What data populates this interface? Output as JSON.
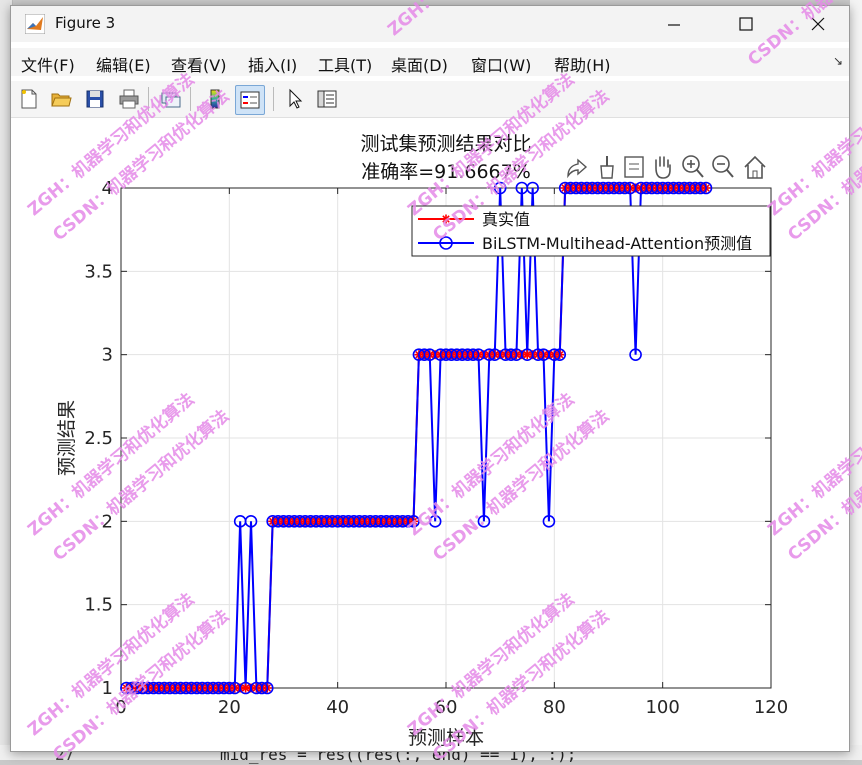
{
  "window": {
    "title": "Figure 3"
  },
  "menubar": {
    "items": [
      {
        "label": "文件(F)"
      },
      {
        "label": "编辑(E)"
      },
      {
        "label": "查看(V)"
      },
      {
        "label": "插入(I)"
      },
      {
        "label": "工具(T)"
      },
      {
        "label": "桌面(D)"
      },
      {
        "label": "窗口(W)"
      },
      {
        "label": "帮助(H)"
      }
    ]
  },
  "toolbar": {
    "buttons": [
      "new-figure",
      "open-file",
      "save",
      "print",
      "link-data",
      "colorbar",
      "legend",
      "pointer",
      "property-inspector"
    ]
  },
  "background": {
    "code_line": "mid_res = res((res(:, end) == 1), :);",
    "line_number": "27"
  },
  "watermark": {
    "line1": "ZGH：机器学习和优化算法",
    "line2": "CSDN：机器学习和优化算法"
  },
  "chart_data": {
    "type": "line",
    "title": "测试集预测结果对比",
    "subtitle": "准确率=91.6667%",
    "xlabel": "预测样本",
    "ylabel": "预测结果",
    "xlim": [
      0,
      120
    ],
    "ylim": [
      1,
      4
    ],
    "xticks": [
      "0",
      "20",
      "40",
      "60",
      "80",
      "100",
      "120"
    ],
    "yticks": [
      "1",
      "1.5",
      "2",
      "2.5",
      "3",
      "3.5",
      "4"
    ],
    "grid": true,
    "legend_position": "top-right",
    "series": [
      {
        "name": "真实值",
        "color": "#ff0000",
        "marker": "asterisk",
        "values": [
          1,
          1,
          1,
          1,
          1,
          1,
          1,
          1,
          1,
          1,
          1,
          1,
          1,
          1,
          1,
          1,
          1,
          1,
          1,
          1,
          1,
          1,
          1,
          1,
          1,
          1,
          1,
          2,
          2,
          2,
          2,
          2,
          2,
          2,
          2,
          2,
          2,
          2,
          2,
          2,
          2,
          2,
          2,
          2,
          2,
          2,
          2,
          2,
          2,
          2,
          2,
          2,
          2,
          2,
          3,
          3,
          3,
          3,
          3,
          3,
          3,
          3,
          3,
          3,
          3,
          3,
          3,
          3,
          3,
          3,
          3,
          3,
          3,
          3,
          3,
          3,
          3,
          3,
          3,
          3,
          3,
          4,
          4,
          4,
          4,
          4,
          4,
          4,
          4,
          4,
          4,
          4,
          4,
          4,
          4,
          4,
          4,
          4,
          4,
          4,
          4,
          4,
          4,
          4,
          4,
          4,
          4,
          4
        ]
      },
      {
        "name": "BiLSTM-Multihead-Attention预测值",
        "color": "#0000ff",
        "marker": "circle",
        "values": [
          1,
          1,
          1,
          1,
          1,
          1,
          1,
          1,
          1,
          1,
          1,
          1,
          1,
          1,
          1,
          1,
          1,
          1,
          1,
          1,
          1,
          2,
          1,
          2,
          1,
          1,
          1,
          2,
          2,
          2,
          2,
          2,
          2,
          2,
          2,
          2,
          2,
          2,
          2,
          2,
          2,
          2,
          2,
          2,
          2,
          2,
          2,
          2,
          2,
          2,
          2,
          2,
          2,
          2,
          3,
          3,
          3,
          2,
          3,
          3,
          3,
          3,
          3,
          3,
          3,
          3,
          2,
          3,
          3,
          4,
          3,
          3,
          3,
          4,
          3,
          4,
          3,
          3,
          2,
          3,
          3,
          4,
          4,
          4,
          4,
          4,
          4,
          4,
          4,
          4,
          4,
          4,
          4,
          4,
          3,
          4,
          4,
          4,
          4,
          4,
          4,
          4,
          4,
          4,
          4,
          4,
          4,
          4
        ]
      }
    ]
  }
}
